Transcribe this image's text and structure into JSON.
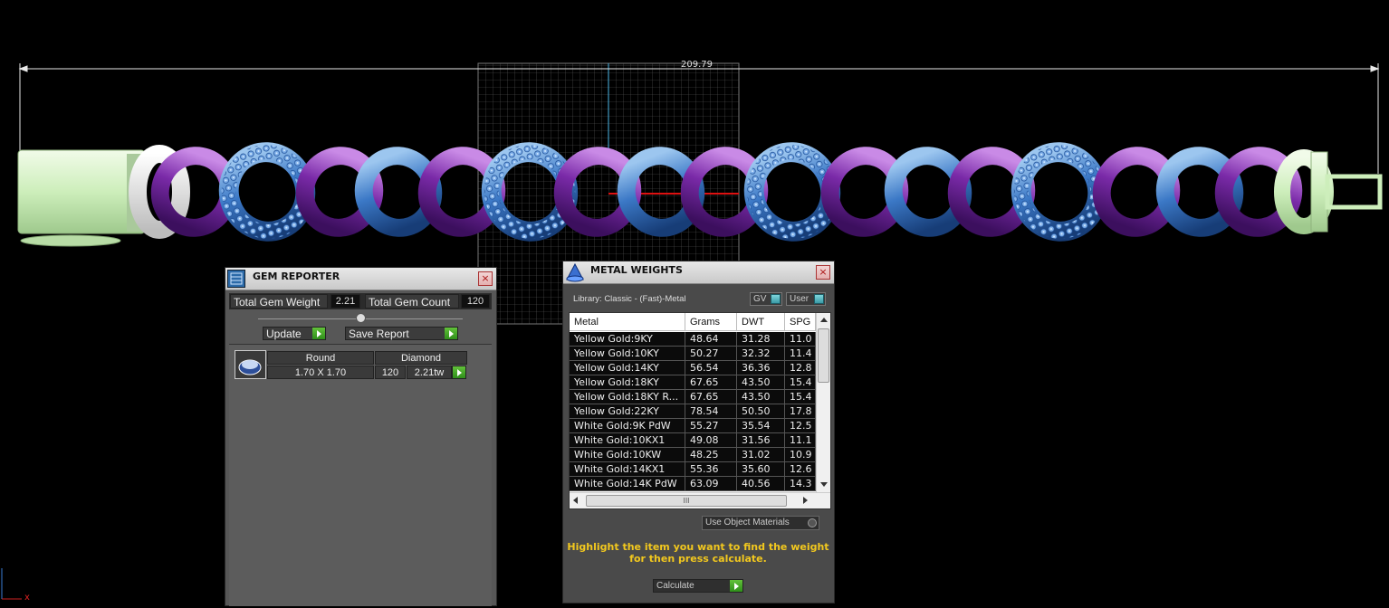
{
  "viewport": {
    "dimension_value": "209.79",
    "axis_x_label": "x"
  },
  "gem_reporter": {
    "title": "GEM REPORTER",
    "total_gem_weight_label": "Total Gem Weight",
    "total_gem_weight_value": "2.21",
    "total_gem_count_label": "Total Gem Count",
    "total_gem_count_value": "120",
    "update_label": "Update",
    "save_report_label": "Save Report",
    "close_label": "×",
    "gem_row": {
      "shape": "Round",
      "material": "Diamond",
      "size": "1.70 X 1.70",
      "count": "120",
      "weight": "2.21tw"
    }
  },
  "metal_weights": {
    "title": "METAL WEIGHTS",
    "close_label": "×",
    "library_label": "Library: Classic - (Fast)-Metal",
    "gv_label": "GV",
    "user_label": "User",
    "columns": [
      "Metal",
      "Grams",
      "DWT",
      "SPG"
    ],
    "rows": [
      {
        "metal": "Yellow Gold:9KY",
        "grams": "48.64",
        "dwt": "31.28",
        "spg": "11.0"
      },
      {
        "metal": "Yellow Gold:10KY",
        "grams": "50.27",
        "dwt": "32.32",
        "spg": "11.4"
      },
      {
        "metal": "Yellow Gold:14KY",
        "grams": "56.54",
        "dwt": "36.36",
        "spg": "12.8"
      },
      {
        "metal": "Yellow Gold:18KY",
        "grams": "67.65",
        "dwt": "43.50",
        "spg": "15.4"
      },
      {
        "metal": "Yellow Gold:18KY R...",
        "grams": "67.65",
        "dwt": "43.50",
        "spg": "15.4"
      },
      {
        "metal": "Yellow Gold:22KY",
        "grams": "78.54",
        "dwt": "50.50",
        "spg": "17.8"
      },
      {
        "metal": "White Gold:9K PdW",
        "grams": "55.27",
        "dwt": "35.54",
        "spg": "12.5"
      },
      {
        "metal": "White Gold:10KX1",
        "grams": "49.08",
        "dwt": "31.56",
        "spg": "11.1"
      },
      {
        "metal": "White Gold:10KW",
        "grams": "48.25",
        "dwt": "31.02",
        "spg": "10.9"
      },
      {
        "metal": "White Gold:14KX1",
        "grams": "55.36",
        "dwt": "35.60",
        "spg": "12.6"
      },
      {
        "metal": "White Gold:14K PdW",
        "grams": "63.09",
        "dwt": "40.56",
        "spg": "14.3"
      }
    ],
    "hscroll_grip": "III",
    "use_object_materials_label": "Use Object Materials",
    "hint_line1": "Highlight the item you want to find the weight",
    "hint_line2": "for then press calculate.",
    "calculate_label": "Calculate"
  }
}
